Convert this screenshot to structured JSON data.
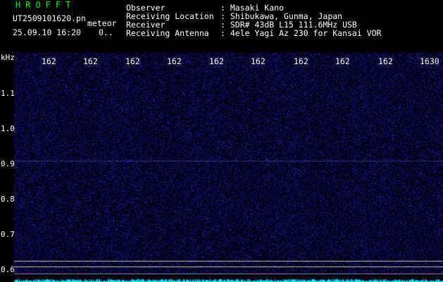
{
  "header": {
    "brand": "HROFFT",
    "filename": "UT2509101620.pn",
    "suffix": "meteor",
    "datetime": "25.09.10 16:20",
    "count": "0.."
  },
  "meta": [
    {
      "label": "Observer",
      "value": ": Masaki Kano"
    },
    {
      "label": "Receiving Location",
      "value": ": Shibukawa, Gunma, Japan"
    },
    {
      "label": "Receiver",
      "value": ": SDR# 43dB L15 111.6MHz USB"
    },
    {
      "label": "Receiving Antenna",
      "value": ": 4ele Yagi Az 230 for Kansai VOR"
    }
  ],
  "axis": {
    "y_unit": "kHz",
    "y_ticks": [
      "1.1",
      "1.0",
      "0.9",
      "0.8",
      "0.7",
      "0.6"
    ],
    "x_ticks": [
      "162",
      "162",
      "162",
      "162",
      "162",
      "162",
      "162",
      "162",
      "162",
      "1630"
    ]
  },
  "colors": {
    "text": "#ffffff",
    "brand": "#00ff00",
    "signal": "#00ffff",
    "background": "#000000",
    "noise": "#1a1ab0"
  }
}
